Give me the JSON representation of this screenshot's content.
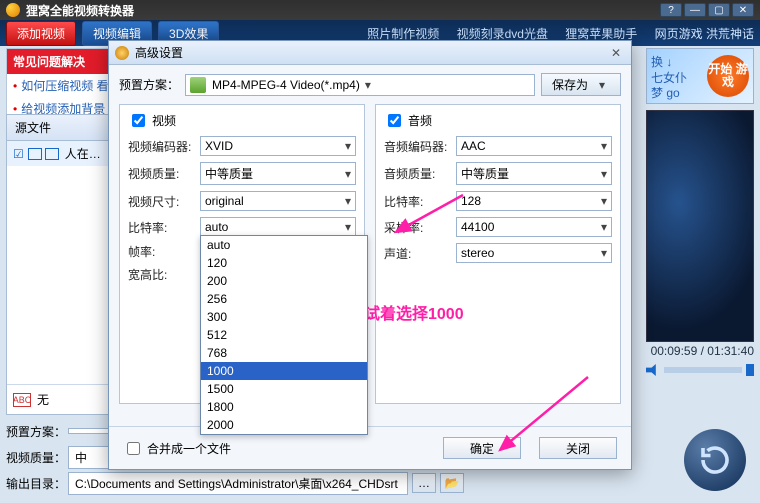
{
  "app": {
    "title": "狸窝全能视频转换器"
  },
  "tabs": {
    "add": "添加视频",
    "edit": "视频编辑",
    "fx": "3D效果"
  },
  "links": {
    "a": "照片制作视频",
    "b": "视频刻录dvd光盘",
    "c": "狸窝苹果助手",
    "d": "网页游戏 洪荒神话"
  },
  "faq": {
    "title": "常见问题解决",
    "i1": "如何压缩视频 看",
    "i2": "给视频添加背景"
  },
  "left": {
    "head": "源文件",
    "file": "人在…",
    "status": "无"
  },
  "banner": {
    "line1": "换 ↓",
    "line2": "七女仆",
    "line3": "梦 go",
    "start": "开始\n游戏"
  },
  "time": {
    "text": "00:09:59 / 01:31:40"
  },
  "bottom": {
    "scheme_label": "预置方案：",
    "scheme_value": "",
    "quality_label": "视频质量：",
    "quality_value": "中",
    "out_label": "输出目录：",
    "out_value": "C:\\Documents and Settings\\Administrator\\桌面\\x264_CHDsrt"
  },
  "dialog": {
    "title": "高级设置",
    "scheme_label": "预置方案：",
    "scheme_value": "MP4-MPEG-4 Video(*.mp4)",
    "save_as": "保存为",
    "video": {
      "title": "视频",
      "encoder_l": "视频编码器:",
      "encoder_v": "XVID",
      "quality_l": "视频质量:",
      "quality_v": "中等质量",
      "size_l": "视频尺寸:",
      "size_v": "original",
      "bitrate_l": "比特率:",
      "bitrate_v": "auto",
      "fps_l": "帧率:",
      "aspect_l": "宽高比:"
    },
    "audio": {
      "title": "音频",
      "encoder_l": "音频编码器:",
      "encoder_v": "AAC",
      "quality_l": "音频质量:",
      "quality_v": "中等质量",
      "bitrate_l": "比特率:",
      "bitrate_v": "128",
      "sample_l": "采样率:",
      "sample_v": "44100",
      "channel_l": "声道:",
      "channel_v": "stereo"
    },
    "bitrate_options": [
      "auto",
      "120",
      "200",
      "256",
      "300",
      "512",
      "768",
      "1000",
      "1500",
      "1800",
      "2000"
    ],
    "bitrate_selected": "1000",
    "merge": "合并成一个文件",
    "ok": "确定",
    "cancel": "关闭"
  },
  "anno": {
    "text": "试着选择1000"
  }
}
